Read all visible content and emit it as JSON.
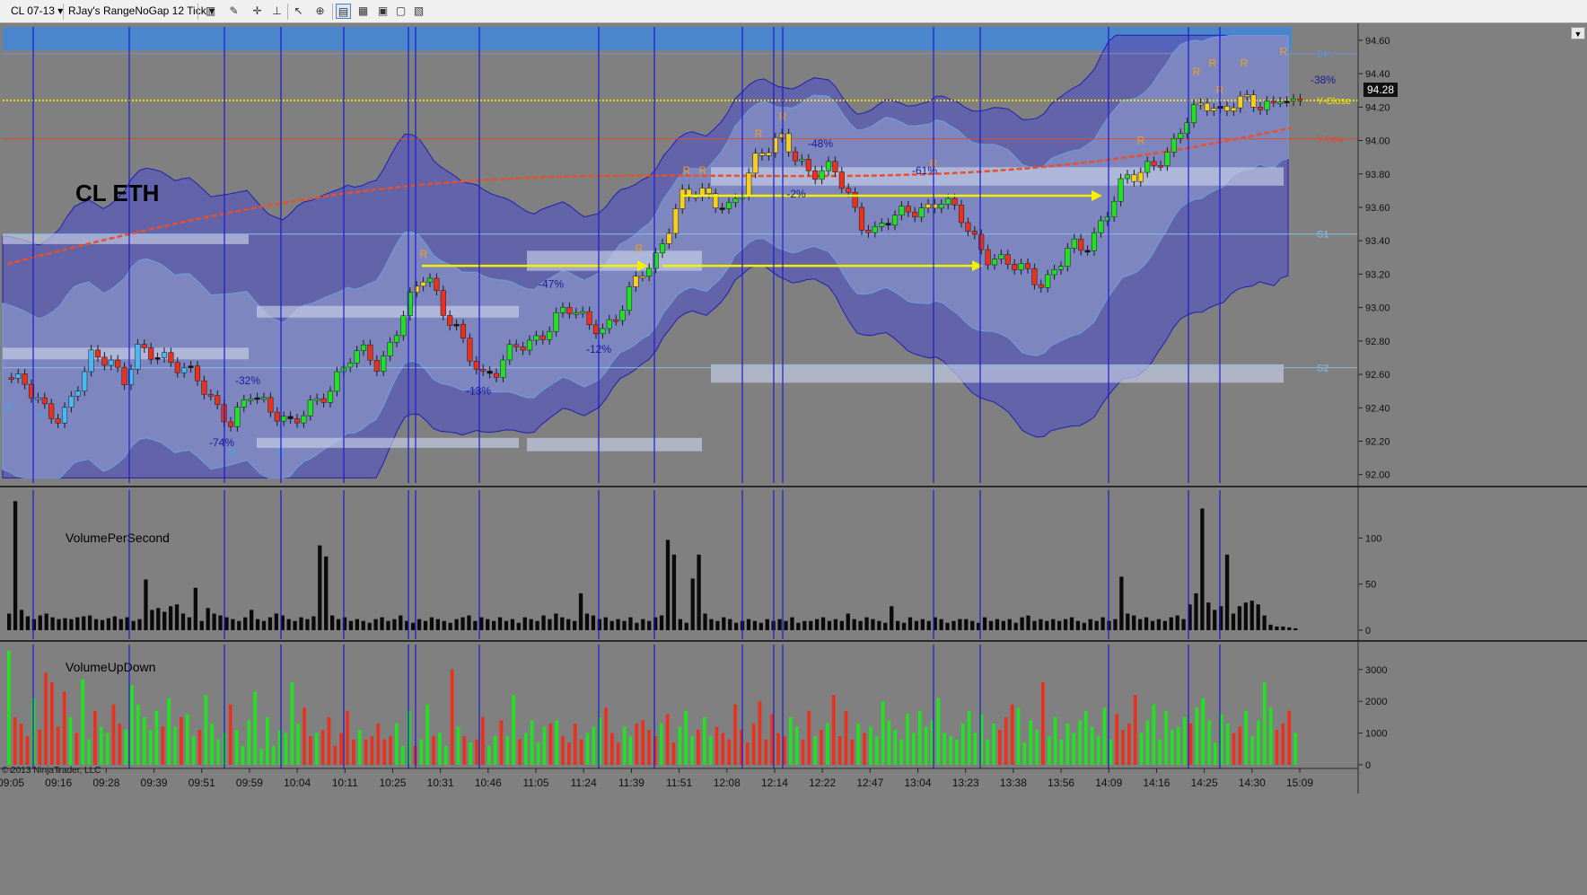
{
  "toolbar": {
    "instrument": "CL 07-13",
    "chart_type": "RJay's RangeNoGap  12 Tick"
  },
  "chart_data": [
    {
      "type": "candlestick",
      "title": "CL ETH",
      "ylim": [
        91.95,
        94.68
      ],
      "y_ticks": [
        92.0,
        92.2,
        92.4,
        92.6,
        92.8,
        93.0,
        93.2,
        93.4,
        93.6,
        93.8,
        94.0,
        94.2,
        94.4,
        94.6
      ],
      "x_ticks": [
        "09:05",
        "09:16",
        "09:28",
        "09:39",
        "09:51",
        "09:59",
        "10:04",
        "10:11",
        "10:25",
        "10:31",
        "10:46",
        "11:05",
        "11:24",
        "11:39",
        "11:51",
        "12:08",
        "12:14",
        "12:22",
        "12:47",
        "13:04",
        "13:23",
        "13:38",
        "13:56",
        "14:09",
        "14:16",
        "14:25",
        "14:30",
        "15:09"
      ],
      "last_price": "94.28",
      "last_change": "-38%",
      "levels": [
        {
          "label": "DP",
          "value": 94.52,
          "color": "#6a8fd4"
        },
        {
          "label": "Y-Close",
          "value": 94.24,
          "color": "#f2e000"
        },
        {
          "label": "Y-Low",
          "value": 94.01,
          "color": "#e04a2a"
        },
        {
          "label": "S1",
          "value": 93.44,
          "color": "#87bde8"
        },
        {
          "label": "S2",
          "value": 92.64,
          "color": "#87bde8"
        }
      ],
      "annotations": [
        {
          "text": "-74%",
          "x": 247,
          "value": 92.17
        },
        {
          "text": "-32%",
          "x": 276,
          "value": 92.54
        },
        {
          "text": "-13%",
          "x": 533,
          "value": 92.48
        },
        {
          "text": "-47%",
          "x": 614,
          "value": 93.12
        },
        {
          "text": "-12%",
          "x": 667,
          "value": 92.73
        },
        {
          "text": "-2%",
          "x": 887,
          "value": 93.66
        },
        {
          "text": "-48%",
          "x": 914,
          "value": 93.96
        },
        {
          "text": "-61%",
          "x": 1030,
          "value": 93.8
        }
      ],
      "r_markers": [
        {
          "x": 11,
          "value": 92.38,
          "color": "#4aa0e0"
        },
        {
          "x": 46,
          "value": 92.33,
          "color": "#4aa0e0"
        },
        {
          "x": 259,
          "value": 92.11,
          "color": "#4aa0e0"
        },
        {
          "x": 313,
          "value": 92.11,
          "color": "#4aa0e0"
        },
        {
          "x": 472,
          "value": 93.3,
          "color": "#f0a020"
        },
        {
          "x": 712,
          "value": 93.33,
          "color": "#f0a020"
        },
        {
          "x": 765,
          "value": 93.8,
          "color": "#f0a020"
        },
        {
          "x": 783,
          "value": 93.8,
          "color": "#f0a020"
        },
        {
          "x": 845,
          "value": 94.02,
          "color": "#f0a020"
        },
        {
          "x": 872,
          "value": 94.12,
          "color": "#f0a020"
        },
        {
          "x": 1040,
          "value": 93.84,
          "color": "#f0a020"
        },
        {
          "x": 1271,
          "value": 93.98,
          "color": "#f0a020"
        },
        {
          "x": 1333,
          "value": 94.39,
          "color": "#f0a020"
        },
        {
          "x": 1351,
          "value": 94.44,
          "color": "#f0a020"
        },
        {
          "x": 1359,
          "value": 94.28,
          "color": "#f0a020"
        },
        {
          "x": 1386,
          "value": 94.44,
          "color": "#f0a020"
        },
        {
          "x": 1430,
          "value": 94.51,
          "color": "#f0a020"
        }
      ],
      "arrows": [
        {
          "x1": 470,
          "x2": 722,
          "value": 93.25
        },
        {
          "x1": 738,
          "x2": 1095,
          "value": 93.25
        },
        {
          "x1": 760,
          "x2": 1228,
          "value": 93.67
        }
      ],
      "zones": [
        {
          "x1": 3,
          "x2": 277,
          "lo": 93.38,
          "hi": 93.44
        },
        {
          "x1": 3,
          "x2": 277,
          "lo": 92.69,
          "hi": 92.76
        },
        {
          "x1": 286,
          "x2": 578,
          "lo": 92.94,
          "hi": 93.01
        },
        {
          "x1": 286,
          "x2": 578,
          "lo": 92.16,
          "hi": 92.22
        },
        {
          "x1": 587,
          "x2": 782,
          "lo": 93.22,
          "hi": 93.34
        },
        {
          "x1": 587,
          "x2": 782,
          "lo": 92.14,
          "hi": 92.22
        },
        {
          "x1": 792,
          "x2": 1430,
          "lo": 93.73,
          "hi": 93.84
        },
        {
          "x1": 792,
          "x2": 1430,
          "lo": 92.55,
          "hi": 92.66
        }
      ],
      "session_lines_x": [
        37,
        144,
        250,
        313,
        383,
        455,
        463,
        534,
        667,
        729,
        827,
        862,
        872,
        1040,
        1092,
        1235,
        1324,
        1359
      ],
      "price_path": [
        [
          8,
          92.58
        ],
        [
          25,
          92.55
        ],
        [
          45,
          92.4
        ],
        [
          65,
          92.32
        ],
        [
          85,
          92.55
        ],
        [
          100,
          92.72
        ],
        [
          120,
          92.68
        ],
        [
          135,
          92.55
        ],
        [
          150,
          92.75
        ],
        [
          170,
          92.72
        ],
        [
          195,
          92.65
        ],
        [
          215,
          92.6
        ],
        [
          235,
          92.42
        ],
        [
          255,
          92.3
        ],
        [
          275,
          92.5
        ],
        [
          300,
          92.38
        ],
        [
          320,
          92.3
        ],
        [
          345,
          92.42
        ],
        [
          365,
          92.5
        ],
        [
          385,
          92.7
        ],
        [
          405,
          92.75
        ],
        [
          420,
          92.62
        ],
        [
          440,
          92.88
        ],
        [
          458,
          93.1
        ],
        [
          472,
          93.22
        ],
        [
          490,
          92.98
        ],
        [
          505,
          92.88
        ],
        [
          520,
          92.72
        ],
        [
          535,
          92.58
        ],
        [
          550,
          92.62
        ],
        [
          570,
          92.78
        ],
        [
          590,
          92.78
        ],
        [
          610,
          92.88
        ],
        [
          628,
          93.02
        ],
        [
          650,
          92.92
        ],
        [
          670,
          92.85
        ],
        [
          690,
          93.0
        ],
        [
          710,
          93.22
        ],
        [
          725,
          93.25
        ],
        [
          740,
          93.45
        ],
        [
          758,
          93.68
        ],
        [
          775,
          93.7
        ],
        [
          790,
          93.65
        ],
        [
          808,
          93.58
        ],
        [
          825,
          93.72
        ],
        [
          840,
          93.9
        ],
        [
          858,
          93.98
        ],
        [
          870,
          94.02
        ],
        [
          885,
          93.88
        ],
        [
          900,
          93.8
        ],
        [
          915,
          93.82
        ],
        [
          925,
          93.85
        ],
        [
          940,
          93.7
        ],
        [
          955,
          93.5
        ],
        [
          972,
          93.45
        ],
        [
          990,
          93.55
        ],
        [
          1010,
          93.58
        ],
        [
          1030,
          93.58
        ],
        [
          1045,
          93.65
        ],
        [
          1065,
          93.58
        ],
        [
          1080,
          93.42
        ],
        [
          1100,
          93.28
        ],
        [
          1120,
          93.28
        ],
        [
          1140,
          93.22
        ],
        [
          1160,
          93.12
        ],
        [
          1175,
          93.25
        ],
        [
          1190,
          93.38
        ],
        [
          1205,
          93.35
        ],
        [
          1220,
          93.45
        ],
        [
          1235,
          93.62
        ],
        [
          1250,
          93.78
        ],
        [
          1265,
          93.8
        ],
        [
          1280,
          93.85
        ],
        [
          1300,
          93.92
        ],
        [
          1315,
          94.1
        ],
        [
          1330,
          94.2
        ],
        [
          1345,
          94.22
        ],
        [
          1360,
          94.15
        ],
        [
          1375,
          94.26
        ],
        [
          1395,
          94.22
        ],
        [
          1415,
          94.2
        ],
        [
          1425,
          94.28
        ],
        [
          1440,
          94.2
        ],
        [
          1448,
          94.25
        ]
      ]
    },
    {
      "type": "bar",
      "title": "VolumePerSecond",
      "ylim": [
        0,
        150
      ],
      "y_ticks": [
        0,
        50,
        100
      ],
      "values": [
        18,
        140,
        22,
        15,
        12,
        16,
        18,
        14,
        12,
        13,
        12,
        14,
        15,
        16,
        12,
        11,
        13,
        15,
        12,
        14,
        10,
        12,
        55,
        22,
        24,
        20,
        26,
        28,
        18,
        14,
        46,
        10,
        24,
        18,
        16,
        14,
        12,
        10,
        14,
        22,
        12,
        10,
        14,
        18,
        16,
        12,
        10,
        14,
        12,
        15,
        92,
        80,
        16,
        12,
        14,
        10,
        12,
        10,
        8,
        12,
        14,
        10,
        12,
        16,
        10,
        8,
        12,
        10,
        14,
        12,
        10,
        8,
        12,
        14,
        16,
        10,
        14,
        12,
        10,
        14,
        10,
        12,
        8,
        14,
        12,
        10,
        16,
        12,
        18,
        14,
        12,
        10,
        40,
        18,
        16,
        12,
        14,
        10,
        12,
        10,
        14,
        8,
        12,
        10,
        14,
        16,
        98,
        82,
        12,
        8,
        56,
        82,
        18,
        12,
        10,
        14,
        12,
        8,
        10,
        12,
        10,
        8,
        12,
        10,
        12,
        10,
        14,
        8,
        10,
        10,
        12,
        14,
        10,
        12,
        10,
        18,
        12,
        10,
        14,
        12,
        10,
        8,
        26,
        10,
        8,
        14,
        10,
        12,
        10,
        14,
        12,
        8,
        10,
        12,
        12,
        10,
        8,
        14,
        10,
        12,
        10,
        12,
        8,
        14,
        16,
        10,
        12,
        10,
        12,
        10,
        12,
        14,
        10,
        8,
        12,
        10,
        14,
        10,
        12,
        58,
        18,
        16,
        12,
        14,
        10,
        12,
        10,
        14,
        16,
        12,
        28,
        40,
        132,
        30,
        22,
        26,
        82,
        18,
        26,
        30,
        32,
        28,
        16,
        6,
        4,
        4,
        3,
        2
      ]
    },
    {
      "type": "bar",
      "title": "VolumeUpDown",
      "ylim": [
        0,
        3700
      ],
      "y_ticks": [
        0,
        1000,
        2000,
        3000
      ],
      "values": [
        3600,
        1500,
        1300,
        900,
        2100,
        1100,
        2900,
        2600,
        1200,
        2300,
        1500,
        1000,
        2700,
        800,
        1700,
        1200,
        1000,
        1900,
        1300,
        1100,
        2500,
        1900,
        1500,
        1100,
        1700,
        1200,
        2100,
        1200,
        1500,
        1600,
        900,
        1100,
        2200,
        1300,
        800,
        1000,
        1900,
        1100,
        600,
        1400,
        2300,
        500,
        1500,
        600,
        1100,
        1000,
        2600,
        1300,
        1800,
        900,
        1000,
        1100,
        1500,
        600,
        1000,
        1700,
        800,
        1100,
        800,
        900,
        1300,
        800,
        900,
        1300,
        600,
        1700,
        600,
        800,
        1900,
        900,
        1000,
        600,
        3000,
        1200,
        900,
        700,
        800,
        1500,
        600,
        900,
        1400,
        900,
        2200,
        800,
        1000,
        1400,
        700,
        1200,
        1300,
        1400,
        900,
        700,
        1300,
        800,
        1000,
        1200,
        1500,
        1800,
        1000,
        700,
        1200,
        900,
        1300,
        1400,
        1100,
        900,
        1300,
        1600,
        700,
        1200,
        1700,
        900,
        1100,
        1500,
        900,
        1200,
        1000,
        800,
        1900,
        1100,
        700,
        1300,
        2000,
        800,
        1600,
        1000,
        900,
        1500,
        1200,
        800,
        1700,
        900,
        1100,
        1300,
        2200,
        900,
        1700,
        800,
        1300,
        1000,
        1200,
        900,
        2000,
        1400,
        1100,
        800,
        1600,
        1000,
        1700,
        1200,
        1400,
        2100,
        1000,
        900,
        800,
        1300,
        1700,
        1000,
        1600,
        800,
        1300,
        1100,
        1500,
        1900,
        1800,
        700,
        1400,
        1100,
        2600,
        900,
        1500,
        800,
        1300,
        1000,
        1400,
        1700,
        1200,
        900,
        1800,
        800,
        1600,
        1100,
        1300,
        2200,
        1000,
        1400,
        1900,
        800,
        1700,
        1100,
        1200,
        1500,
        1300,
        1800,
        2100,
        1400,
        700,
        1600,
        1300,
        1000,
        1200,
        1700,
        900,
        1400,
        2600,
        1800,
        1100,
        1300,
        1700,
        1000
      ],
      "colors_pattern": [
        "up",
        "down",
        "down",
        "down",
        "up",
        "down",
        "down",
        "down",
        "down",
        "down",
        "up",
        "down",
        "up",
        "up",
        "down",
        "up",
        "up",
        "down",
        "down",
        "up",
        "up",
        "up",
        "up",
        "up",
        "up",
        "down",
        "up",
        "up",
        "down",
        "up",
        "up",
        "down",
        "up",
        "up",
        "up",
        "up",
        "down",
        "up",
        "up",
        "up",
        "up",
        "up",
        "up",
        "up",
        "up",
        "up",
        "up",
        "up",
        "down",
        "down",
        "up",
        "down",
        "down",
        "down",
        "down",
        "down",
        "down",
        "up",
        "down",
        "down",
        "down",
        "down",
        "down",
        "up",
        "up",
        "up",
        "down",
        "up",
        "up",
        "down",
        "up",
        "up",
        "down",
        "up",
        "down",
        "up",
        "down",
        "down",
        "up",
        "up",
        "down",
        "up",
        "up",
        "down",
        "up",
        "up",
        "up",
        "up",
        "down",
        "up",
        "down",
        "down",
        "down",
        "down",
        "up",
        "up",
        "up",
        "down",
        "down",
        "down",
        "up",
        "up",
        "down",
        "down",
        "down",
        "down",
        "up",
        "down",
        "down",
        "up",
        "up",
        "up",
        "down",
        "up",
        "up",
        "down",
        "down",
        "down",
        "down",
        "down",
        "down",
        "down",
        "down",
        "down",
        "down",
        "down",
        "down",
        "up",
        "up",
        "down",
        "down",
        "up",
        "down",
        "up",
        "down",
        "down",
        "down",
        "down",
        "up",
        "down",
        "up",
        "up",
        "up",
        "up",
        "up",
        "up",
        "up",
        "up",
        "up",
        "up",
        "up",
        "up",
        "up",
        "up",
        "up",
        "up",
        "up",
        "up",
        "up",
        "up",
        "up",
        "down",
        "down",
        "down",
        "up",
        "up",
        "up",
        "up",
        "down",
        "up",
        "up",
        "up",
        "up",
        "up",
        "up",
        "up",
        "up",
        "up",
        "up",
        "up",
        "down",
        "down",
        "down",
        "down",
        "up",
        "up",
        "up",
        "up",
        "up",
        "up",
        "up",
        "up",
        "down",
        "up",
        "up",
        "up",
        "up",
        "up",
        "up",
        "down",
        "down",
        "up",
        "up",
        "up",
        "up"
      ]
    }
  ],
  "footer": {
    "copyright": "© 2013 NinjaTrader, LLC"
  },
  "colors": {
    "up": "#22e022",
    "down": "#e8321e",
    "bullish_highlight": "#f5d020",
    "session_line": "#1a1ad0",
    "background": "#808080",
    "band_outer": "#5a5ab8",
    "band_inner": "#8a96c8"
  }
}
